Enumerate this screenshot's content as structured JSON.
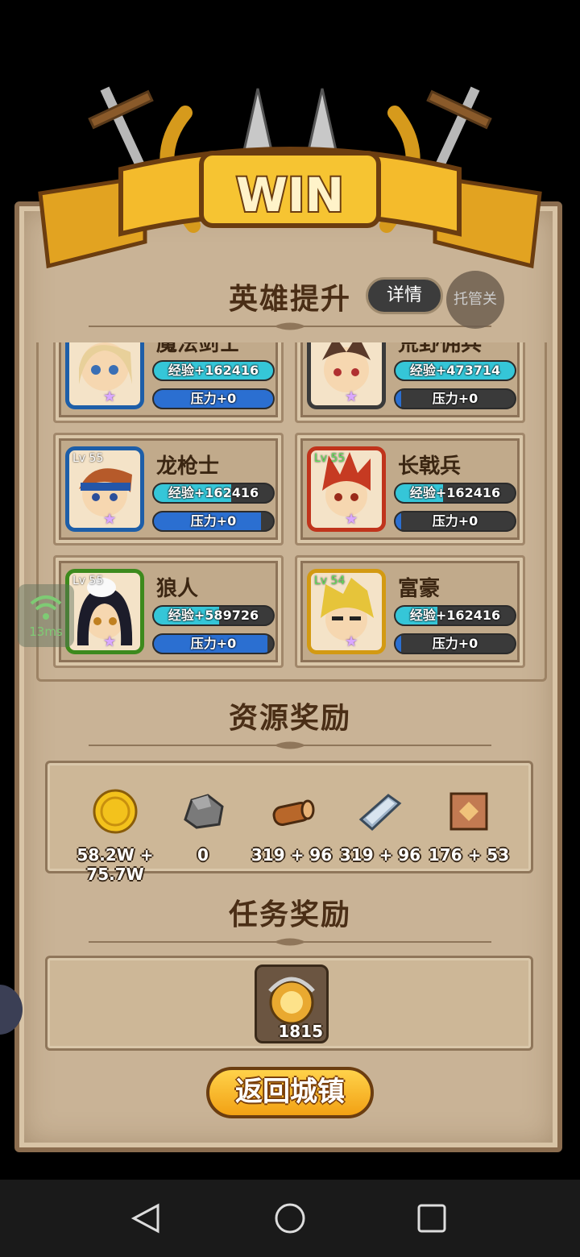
{
  "banner": {
    "title": "WIN"
  },
  "hero_section": {
    "title": "英雄提升",
    "detail_label": "详情",
    "auto_label": "托管关",
    "heroes": [
      {
        "name": "魔法剑士",
        "lv": "",
        "exp": "经验+162416",
        "pressure": "压力+0",
        "frame": "#1d5ea8",
        "exp_fill": 1.0,
        "pressure_fill": 1.0
      },
      {
        "name": "荒野佣兵",
        "lv": "",
        "exp": "经验+473714",
        "pressure": "压力+0",
        "frame": "#3a3a3a",
        "exp_fill": 1.0,
        "pressure_fill": 0.05
      },
      {
        "name": "龙枪士",
        "lv": "Lv 55",
        "exp": "经验+162416",
        "pressure": "压力+0",
        "frame": "#1d5ea8",
        "exp_fill": 0.65,
        "pressure_fill": 0.9
      },
      {
        "name": "长戟兵",
        "lv": "Lv 55",
        "exp": "经验+162416",
        "pressure": "压力+0",
        "frame": "#c0341c",
        "exp_fill": 0.4,
        "pressure_fill": 0.05
      },
      {
        "name": "狼人",
        "lv": "Lv 55",
        "exp": "经验+589726",
        "pressure": "压力+0",
        "frame": "#3d8a1d",
        "exp_fill": 0.55,
        "pressure_fill": 0.95
      },
      {
        "name": "富豪",
        "lv": "Lv 54",
        "exp": "经验+162416",
        "pressure": "压力+0",
        "frame": "#d39a12",
        "exp_fill": 0.35,
        "pressure_fill": 0.05
      }
    ]
  },
  "resource_section": {
    "title": "资源奖励",
    "items": [
      {
        "icon": "gold-coin-icon",
        "value": "58.2W + 75.7W"
      },
      {
        "icon": "stone-icon",
        "value": "0"
      },
      {
        "icon": "wood-log-icon",
        "value": "319 + 96"
      },
      {
        "icon": "iron-ingot-icon",
        "value": "319 + 96"
      },
      {
        "icon": "leather-icon",
        "value": "176 + 53"
      }
    ]
  },
  "task_section": {
    "title": "任务奖励",
    "reward": {
      "icon": "medal-icon",
      "value": "1815"
    }
  },
  "return_button": "返回城镇",
  "network": {
    "latency": "13ms"
  }
}
